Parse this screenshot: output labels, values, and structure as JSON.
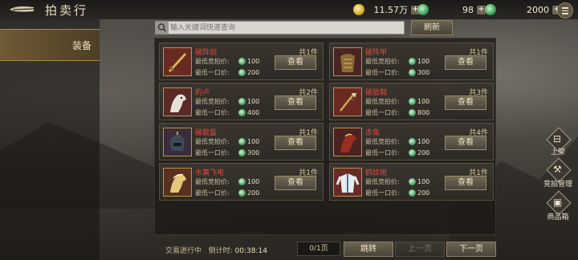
{
  "header": {
    "title": "拍卖行",
    "currencies": [
      {
        "icon": "gold-coin-icon",
        "value": "11.57万"
      },
      {
        "icon": "jade-icon",
        "value": "98"
      },
      {
        "icon": "jade-icon",
        "value": "2000"
      }
    ],
    "plus": "+"
  },
  "sidebar": {
    "items": [
      {
        "label": "装备",
        "selected": true
      }
    ]
  },
  "search": {
    "placeholder": "输入关键词快速查询",
    "value": ""
  },
  "refresh_label": "刷新",
  "labels": {
    "min_bid": "最低竞拍价:",
    "buyout": "最低一口价:",
    "view": "查看"
  },
  "items": [
    {
      "name": "破阵剑",
      "count": "共1件",
      "bid": "100",
      "buyout": "200",
      "thumb": "sword"
    },
    {
      "name": "破阵甲",
      "count": "共1件",
      "bid": "100",
      "buyout": "300",
      "thumb": "armor"
    },
    {
      "name": "的卢",
      "count": "共2件",
      "bid": "100",
      "buyout": "400",
      "thumb": "horse-white"
    },
    {
      "name": "破敌戟",
      "count": "共3件",
      "bid": "100",
      "buyout": "800",
      "thumb": "halberd"
    },
    {
      "name": "破敌盔",
      "count": "共1件",
      "bid": "100",
      "buyout": "300",
      "thumb": "helmet"
    },
    {
      "name": "赤兔",
      "count": "共4件",
      "bid": "100",
      "buyout": "200",
      "thumb": "horse-red"
    },
    {
      "name": "水黄飞电",
      "count": "共1件",
      "bid": "100",
      "buyout": "200",
      "thumb": "horse-yellow"
    },
    {
      "name": "鹤纹袍",
      "count": "共1件",
      "bid": "100",
      "buyout": "200",
      "thumb": "robe"
    }
  ],
  "right_buttons": [
    {
      "label": "上架",
      "icon": "shelf-icon",
      "glyph": "⊟"
    },
    {
      "label": "竞拍管理",
      "icon": "auction-manage-icon",
      "glyph": "⚒"
    },
    {
      "label": "商品箱",
      "icon": "goods-box-icon",
      "glyph": "▣"
    }
  ],
  "footer": {
    "status_label": "交易进行中",
    "countdown_label": "倒计时:",
    "countdown": "00:38:14",
    "page": "0/1页",
    "jump": "跳转",
    "prev": "上一页",
    "next": "下一页"
  },
  "colors": {
    "accent": "#b39553",
    "item_name": "#e24a3c",
    "jade": "#4aa76a",
    "gold": "#d8a92a"
  }
}
